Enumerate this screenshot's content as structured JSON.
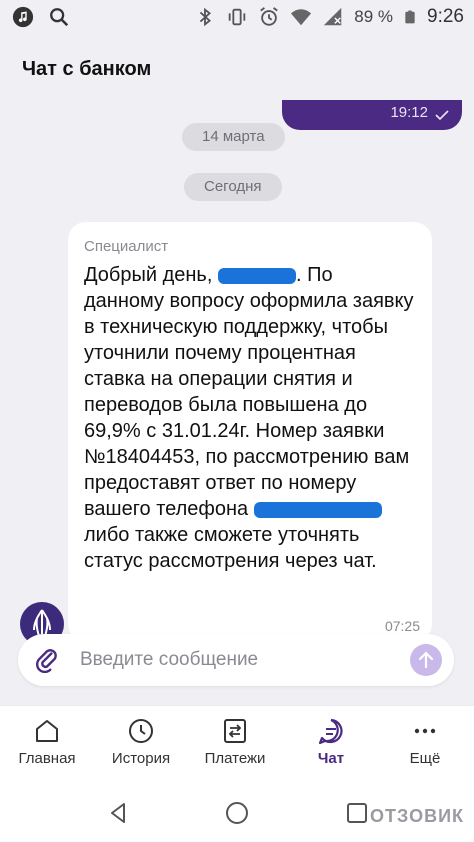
{
  "status_bar": {
    "battery": "89 %",
    "time": "9:26"
  },
  "header": {
    "title": "Чат с банком"
  },
  "chat": {
    "previous_message_time": "19:12",
    "date_separators": [
      "14 марта",
      "Сегодня"
    ],
    "message": {
      "sender": "Специалист",
      "text_part1": "Добрый день, ",
      "text_part2": ". По данному вопросу оформила заявку в техническую поддержку, чтобы уточнили почему процентная ставка на операции снятия и переводов была повышена до 69,9% с 31.01.24г. Номер заявки №18404453, по рассмотрению вам предоставят ответ по номеру вашего телефона ",
      "text_part3": " либо также сможете уточнять статус рассмотрения через чат.",
      "time": "07:25"
    }
  },
  "input": {
    "placeholder": "Введите сообщение"
  },
  "nav": {
    "items": [
      {
        "label": "Главная",
        "icon": "home-icon"
      },
      {
        "label": "История",
        "icon": "clock-icon"
      },
      {
        "label": "Платежи",
        "icon": "payments-icon"
      },
      {
        "label": "Чат",
        "icon": "chat-icon",
        "active": true
      },
      {
        "label": "Ещё",
        "icon": "more-icon"
      }
    ]
  },
  "watermark": "ОТЗОВИК",
  "colors": {
    "accent": "#4b2a83",
    "background": "#f0eff3",
    "bubble": "#ffffff"
  }
}
